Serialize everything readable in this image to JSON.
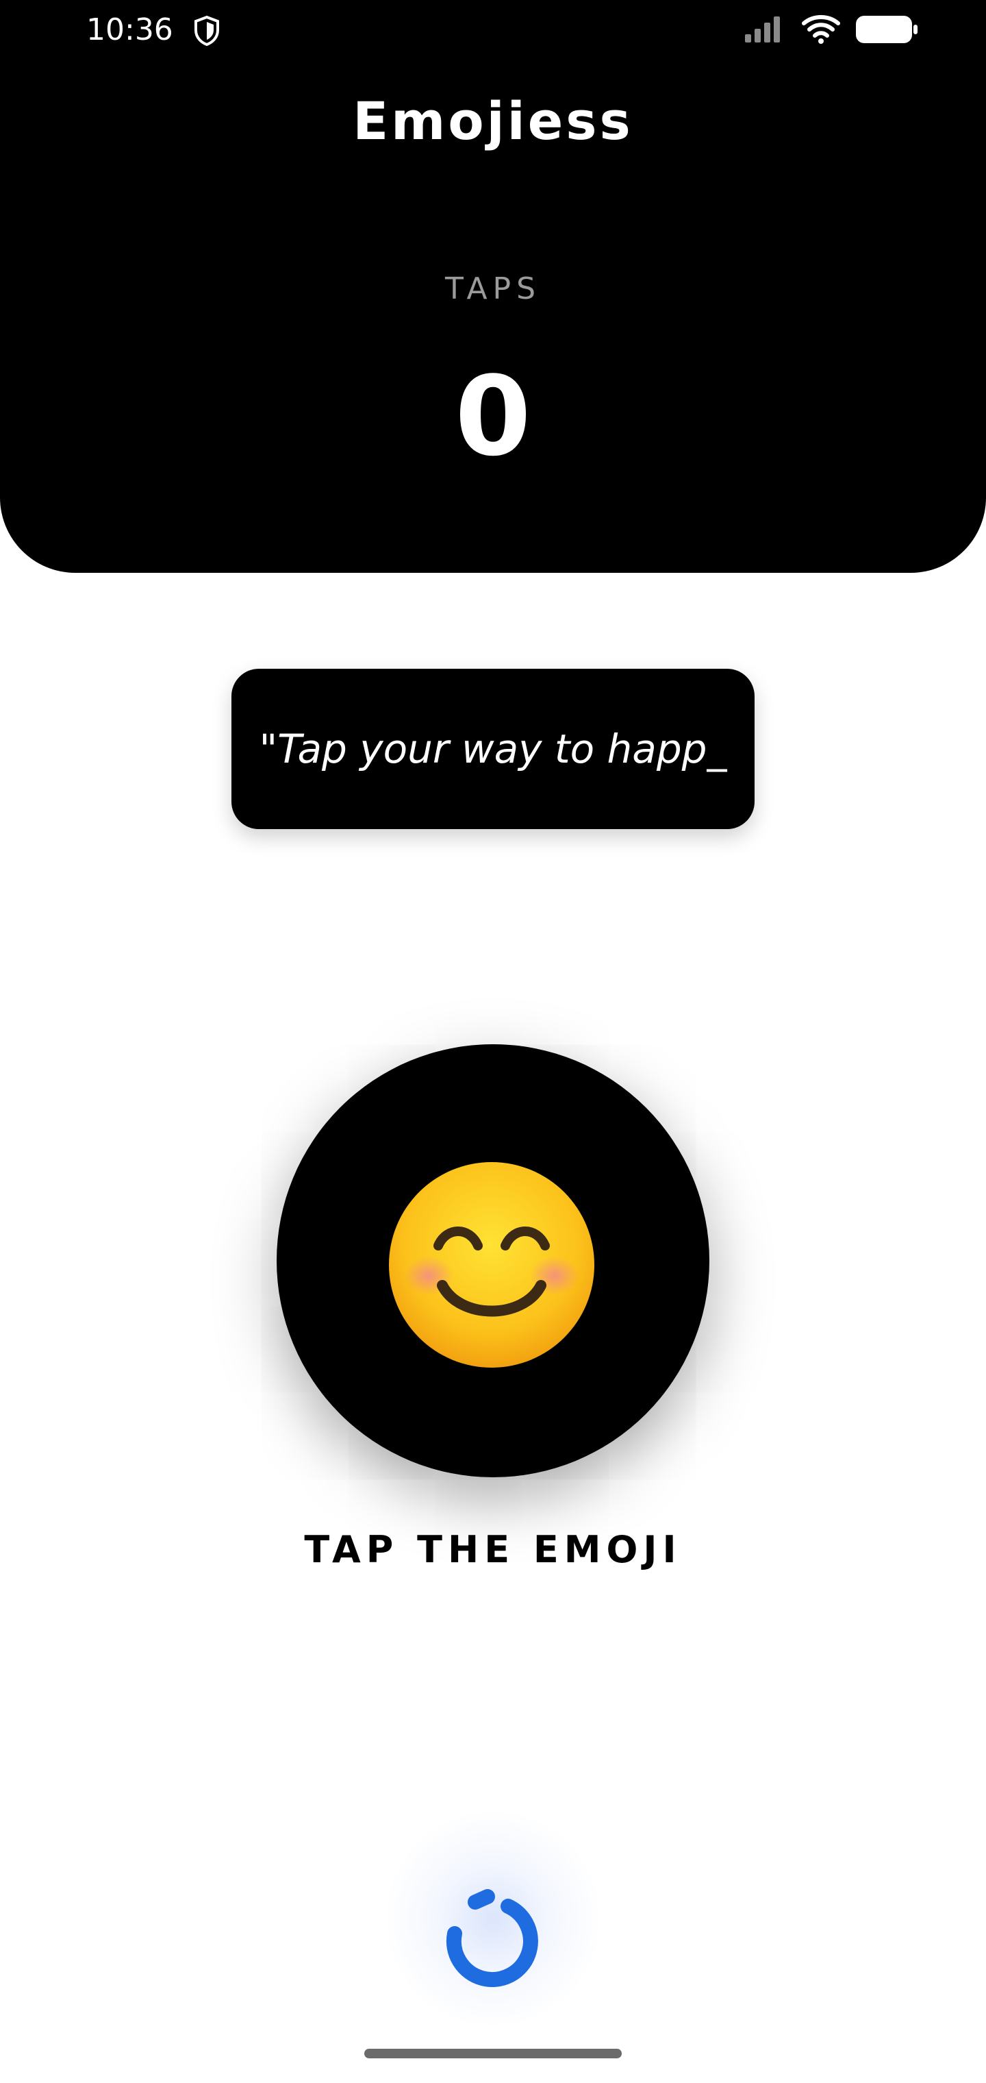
{
  "status_bar": {
    "time": "10:36",
    "icons": [
      "shield-icon",
      "signal-icon",
      "wifi-icon",
      "battery-icon"
    ]
  },
  "header": {
    "title": "Emojiess",
    "taps_label": "TAPS",
    "taps_count": "0"
  },
  "quote": {
    "text": "\"Tap your way to happ_"
  },
  "emoji_button": {
    "emoji": "smiling-face-with-smiling-eyes",
    "instruction": "TAP THE EMOJI"
  },
  "loader": {
    "icon": "loading-spinner-icon",
    "accent": "#1f6be0"
  },
  "colors": {
    "background": "#ffffff",
    "surface": "#000000",
    "accent": "#1f6be0"
  }
}
